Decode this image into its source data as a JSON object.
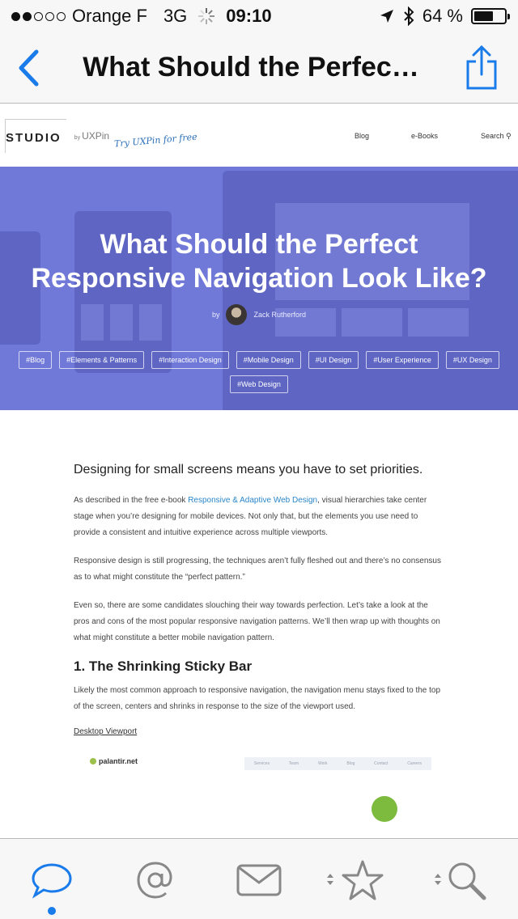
{
  "status_bar": {
    "carrier": "Orange F",
    "network": "3G",
    "time": "09:10",
    "battery": "64 %",
    "battery_level": 0.64
  },
  "nav_bar": {
    "title": "What Should the Perfec…",
    "back_icon": "chevron-left-icon",
    "share_icon": "share-icon",
    "accent": "#1a7bea"
  },
  "site": {
    "brand": "STUDIO",
    "by": "by",
    "uxpin": "UXPin",
    "try_free": "Try UXPin for free",
    "nav": [
      "Blog",
      "e-Books",
      "Search"
    ]
  },
  "hero": {
    "title_line1": "What Should the Perfect",
    "title_line2": "Responsive Navigation Look Like?",
    "by": "by",
    "author": "Zack Rutherford",
    "tags": [
      "#Blog",
      "#Elements & Patterns",
      "#Interaction Design",
      "#Mobile Design",
      "#UI Design",
      "#User Experience",
      "#UX Design",
      "#Web Design"
    ],
    "color": "#7179d8"
  },
  "article": {
    "lead": "Designing for small screens means you have to set priorities.",
    "p1_before": "As described in the free e-book ",
    "p1_link": "Responsive & Adaptive Web Design",
    "p1_after": ", visual hierarchies take center stage when you’re designing for mobile devices. Not only that, but the elements you use need to provide a consistent and intuitive experience across multiple viewports.",
    "p2": "Responsive design is still progressing, the techniques aren’t fully fleshed out and there’s no consensus as to what might constitute the “perfect pattern.”",
    "p3": "Even so, there are some candidates slouching their way towards perfection. Let’s take a look at the pros and cons of the most popular responsive navigation patterns. We’ll then wrap up with thoughts on what might constitute a better mobile navigation pattern.",
    "h2": "1. The Shrinking Sticky Bar",
    "p4": "Likely the most common approach to responsive navigation, the navigation menu stays fixed to the top of the screen, centers and shrinks in response to the size of the viewport used.",
    "desktop_link": "Desktop Viewport",
    "preview_brand": "palantir.net",
    "preview_nav": [
      "Services",
      "Team",
      "Work",
      "Blog",
      "Contact",
      "Careers"
    ]
  },
  "tab_bar": {
    "tabs": [
      "chat-bubble-icon",
      "at-sign-icon",
      "envelope-icon",
      "star-icon",
      "search-icon"
    ],
    "selected": 0
  }
}
